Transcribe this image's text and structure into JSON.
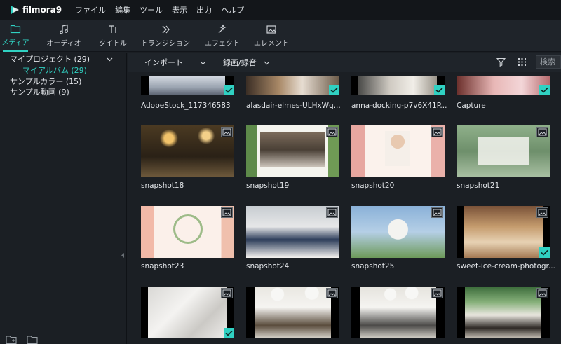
{
  "app": {
    "logo_text": "filmora9",
    "menu": [
      "ファイル",
      "編集",
      "ツール",
      "表示",
      "出力",
      "ヘルプ"
    ]
  },
  "toolbar": {
    "tools": [
      {
        "label": "メディア",
        "icon": "folder-icon",
        "active": true
      },
      {
        "label": "オーディオ",
        "icon": "music-note-icon",
        "active": false
      },
      {
        "label": "タイトル",
        "icon": "text-title-icon",
        "active": false
      },
      {
        "label": "トランジション",
        "icon": "transition-icon",
        "active": false
      },
      {
        "label": "エフェクト",
        "icon": "effect-icon",
        "active": false
      },
      {
        "label": "エレメント",
        "icon": "element-image-icon",
        "active": false
      }
    ]
  },
  "sidebar": {
    "items": [
      {
        "label": "マイプロジェクト (29)"
      },
      {
        "label": "マイアルバム (29)"
      },
      {
        "label": "サンプルカラー (15)"
      },
      {
        "label": "サンプル動画 (9)"
      }
    ]
  },
  "content": {
    "import_label": "インポート",
    "record_label": "録画/録音",
    "search_placeholder": "検索"
  },
  "tiles": [
    {
      "name": "AdobeStock_117346583",
      "checked": true,
      "image_badge": false
    },
    {
      "name": "alasdair-elmes-ULHxWq...",
      "checked": true,
      "image_badge": false
    },
    {
      "name": "anna-docking-p7v6X41P...",
      "checked": true,
      "image_badge": false
    },
    {
      "name": "Capture",
      "checked": true,
      "image_badge": false
    },
    {
      "name": "snapshot18",
      "checked": false,
      "image_badge": true
    },
    {
      "name": "snapshot19",
      "checked": false,
      "image_badge": true
    },
    {
      "name": "snapshot20",
      "checked": false,
      "image_badge": true
    },
    {
      "name": "snapshot21",
      "checked": false,
      "image_badge": true
    },
    {
      "name": "snapshot23",
      "checked": false,
      "image_badge": true
    },
    {
      "name": "snapshot24",
      "checked": false,
      "image_badge": true
    },
    {
      "name": "snapshot25",
      "checked": false,
      "image_badge": true
    },
    {
      "name": "sweet-ice-cream-photogr...",
      "checked": true,
      "image_badge": true
    },
    {
      "name": "",
      "checked": true,
      "image_badge": true
    },
    {
      "name": "",
      "checked": false,
      "image_badge": true
    },
    {
      "name": "",
      "checked": false,
      "image_badge": true
    },
    {
      "name": "",
      "checked": false,
      "image_badge": true
    }
  ],
  "colors": {
    "accent": "#30d1c2",
    "background": "#1b1f24",
    "menubar": "#13161a",
    "toolbar": "#1f242a"
  }
}
